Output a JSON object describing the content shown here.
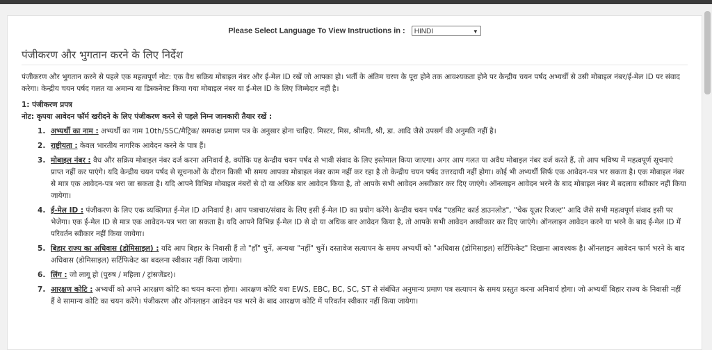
{
  "language_bar": {
    "label": "Please Select Language To View Instructions in :",
    "selected": "HINDI"
  },
  "heading": "पंजीकरण और भुगतान करने के लिए निर्देश",
  "intro": "पंजीकरण और भुगतान करने से पहले एक महत्वपूर्ण नोट: एक वैध सक्रिय मोबाइल नंबर और ई-मेल ID रखें जो आपका हो। भर्ती के अंतिम चरण के पूरा होने तक आवश्यकता होने पर केन्द्रीय चयन पर्षद अभ्यर्थी से उसी मोबाइल नंबर/ई-मेल ID पर संवाद करेगा। केन्द्रीय चयन पर्षद गलत या अमान्य या डिस्कनेक्ट किया गया मोबाइल नंबर या ई-मेल ID के लिए जिम्मेदार नहीं है।",
  "section_title": "1: पंजीकरण प्रपत्र",
  "note": "नोट: कृपया आवेदन फॉर्म खरीदने के लिए पंजीकरण करने से पहले निम्न जानकारी तैयार रखें :",
  "items": [
    {
      "term": "अभ्यर्थी का नाम :",
      "text": " अभ्यर्थी का नाम 10th/SSC/मैट्रिक/ समकक्ष प्रमाण पत्र के अनुसार होना चाहिए. मिस्टर, मिस, श्रीमती, श्री, डा. आदि जैसे उपसर्ग की अनुमति नहीं है।"
    },
    {
      "term": "राष्ट्रीयता :",
      "text": " केवल भारतीय नागरिक आवेदन करने के पात्र हैं।"
    },
    {
      "term": "मोबाइल नंबर :",
      "text": " वैध और सक्रिय मोबाइल नंबर दर्ज करना अनिवार्य है, क्योंकि यह केन्द्रीय चयन पर्षद से भावी संवाद के लिए इस्तेमाल किया जाएगा। अगर आप गलत या अवैध मोबाइल नंबर दर्ज करते हैं, तो आप भविष्य में महत्वपूर्ण सूचनाएं प्राप्त नहीं कर पाएंगे। यदि केन्द्रीय चयन पर्षद से सूचनाओं के दौरान किसी भी समय आपका मोबाइल नंबर काम नहीं कर रहा है तो केन्द्रीय चयन पर्षद उत्तरदायी नहीं होगा। कोई भी अभ्यर्थी सिर्फ एक आवेदन-पत्र भर सकता है। एक मोबाइल नंबर से मात्र एक आवेदन-पत्र भरा जा सकता है। यदि आपने विभिन्न मोबाइल नंबरों से दो या अधिक बार आवेदन किया है, तो आपके सभी आवेदन अस्वीकार कर दिए जाएंगे। ऑनलाइन आवेदन भरने के बाद मोबाइल नंबर में बदलाव स्वीकार नहीं किया जायेगा।"
    },
    {
      "term": "ई-मेल ID :",
      "text": " पंजीकरण के लिए एक व्यक्तिगत ई-मेल ID अनिवार्य है। आप पत्राचार/संवाद के लिए इसी ई-मेल ID का प्रयोग करेंगे। केन्द्रीय चयन पर्षद \"एडमिट कार्ड डाउनलोड\", \"चेक यूज़र रिजल्ट\" आदि जैसे सभी महत्वपूर्ण संवाद इसी पर भेजेगा। एक ई-मेल ID से मात्र एक आवेदन-पत्र भरा जा सकता है। यदि आपने विभिन्न ई-मेल ID से दो या अधिक बार आवेदन किया है, तो आपके सभी आवेदन अस्वीकार कर दिए जाएंगे। ऑनलाइन आवेदन करने या भरने के बाद ई-मेल ID में परिवर्तन स्वीकार नहीं किया जायेगा।"
    },
    {
      "term": "बिहार राज्य का अधिवास (डोमिसाइल) :",
      "text": " यदि आप बिहार के निवासी हैं तो \"हाँ\" चुनें, अन्यथा \"नहीं\" चुनें। दस्तावेज सत्यापन के समय अभ्यर्थी को \"अधिवास (डोमिसाइल) सर्टिफिकेट\" दिखाना आवश्यक है। ऑनलाइन आवेदन फार्म भरने के बाद अधिवास (डोमिसाइल) सर्टिफिकेट का बदलना स्वीकार नहीं किया जायेगा।"
    },
    {
      "term": "लिंग :",
      "text": " जो लागू हो (पुरुष / महिला / ट्रांसजेंडर)।"
    },
    {
      "term": "आरक्षण कोटि :",
      "text": " अभ्यर्थी को अपने आरक्षण कोटि का चयन करना होगा। आरक्षण कोटि यथा EWS, EBC, BC, SC, ST से संबंधित अनुमान्य प्रमाण पत्र सत्यापन के समय प्रस्तुत करना अनिवार्य होगा। जो अभ्यर्थी बिहार राज्य के निवासी नहीं हैं वे सामान्य कोटि का चयन करेंगे। पंजीकरण और ऑनलाइन आवेदन पत्र भरने के बाद आरक्षण कोटि में परिवर्तन स्वीकार नहीं किया जायेगा।"
    }
  ]
}
